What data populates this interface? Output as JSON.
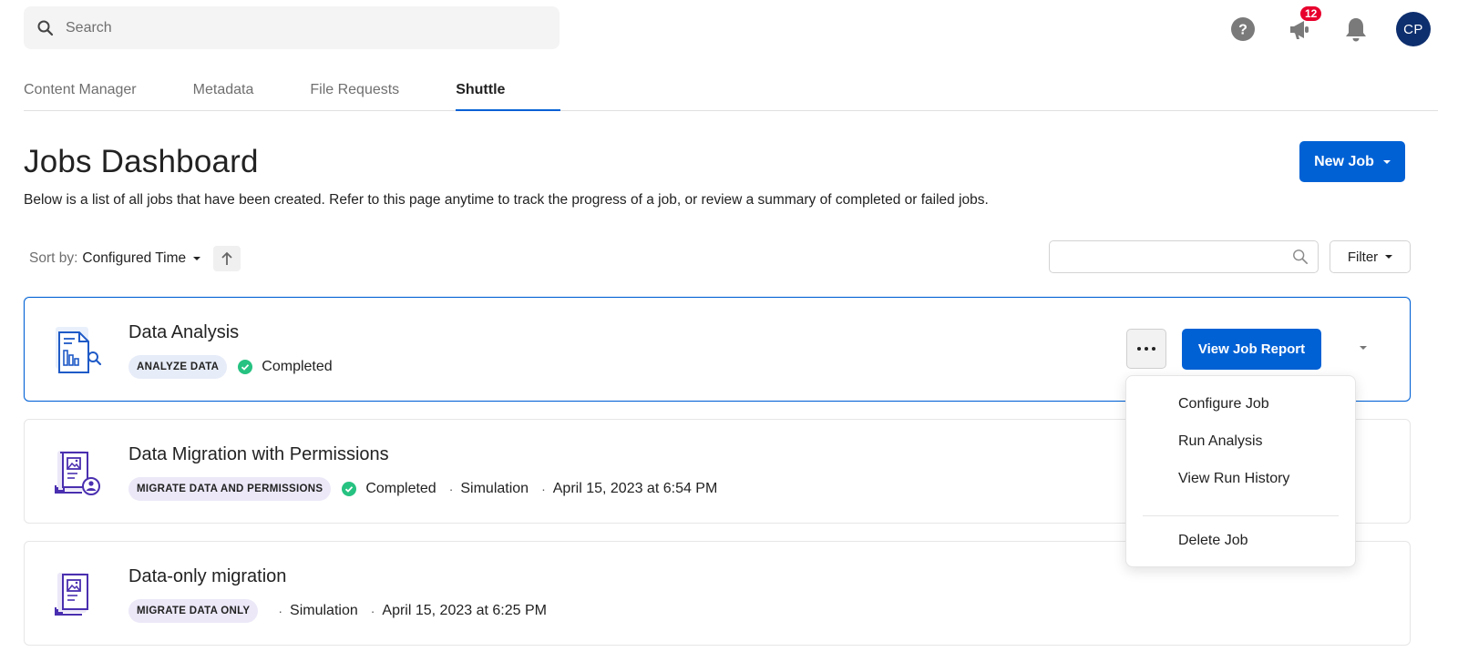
{
  "search": {
    "placeholder": "Search"
  },
  "header_icons": {
    "notification_count": "12",
    "avatar_initials": "CP"
  },
  "tabs": [
    {
      "label": "Content Manager"
    },
    {
      "label": "Metadata"
    },
    {
      "label": "File Requests"
    },
    {
      "label": "Shuttle",
      "active": true
    }
  ],
  "page": {
    "title": "Jobs Dashboard",
    "description": "Below is a list of all jobs that have been created. Refer to this page anytime to track the progress of a job, or review a summary of completed or failed jobs.",
    "new_job_label": "New Job"
  },
  "sort": {
    "label": "Sort by:",
    "value": "Configured Time"
  },
  "filter": {
    "label": "Filter",
    "search_placeholder": ""
  },
  "jobs": [
    {
      "title": "Data Analysis",
      "type": "ANALYZE DATA",
      "status": "Completed"
    },
    {
      "title": "Data Migration with Permissions",
      "type": "MIGRATE DATA AND PERMISSIONS",
      "status": "Completed",
      "mode": "Simulation",
      "date": "April 15, 2023 at 6:54 PM"
    },
    {
      "title": "Data-only migration",
      "type": "MIGRATE DATA ONLY",
      "mode": "Simulation",
      "date": "April 15, 2023 at 6:25 PM"
    }
  ],
  "job_actions": {
    "view_report_label": "View Job Report"
  },
  "menu": {
    "items": [
      "Configure Job",
      "Run Analysis",
      "View Run History"
    ],
    "danger_item": "Delete Job"
  },
  "colors": {
    "accent": "#0061d5",
    "success": "#26c281",
    "badge": "#e8002d",
    "avatar": "#0e2f6e"
  }
}
